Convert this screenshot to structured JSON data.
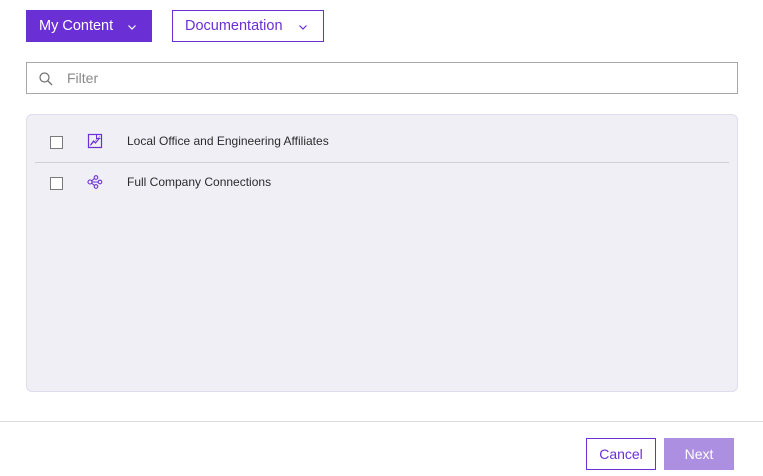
{
  "colors": {
    "accent": "#6b2fd6",
    "accent_disabled": "#ac8fe0",
    "panel_bg": "#f0eff6"
  },
  "toolbar": {
    "content_source_label": "My Content",
    "content_source_icon": "chevron-down-icon",
    "folder_label": "Documentation",
    "folder_icon": "chevron-down-icon"
  },
  "filter": {
    "placeholder": "Filter",
    "value": "",
    "icon": "search-icon"
  },
  "items": [
    {
      "label": "Local Office and Engineering Affiliates",
      "icon": "map-image-icon",
      "checked": false
    },
    {
      "label": "Full Company Connections",
      "icon": "network-icon",
      "checked": false
    }
  ],
  "footer": {
    "cancel_label": "Cancel",
    "next_label": "Next",
    "next_disabled": true
  }
}
